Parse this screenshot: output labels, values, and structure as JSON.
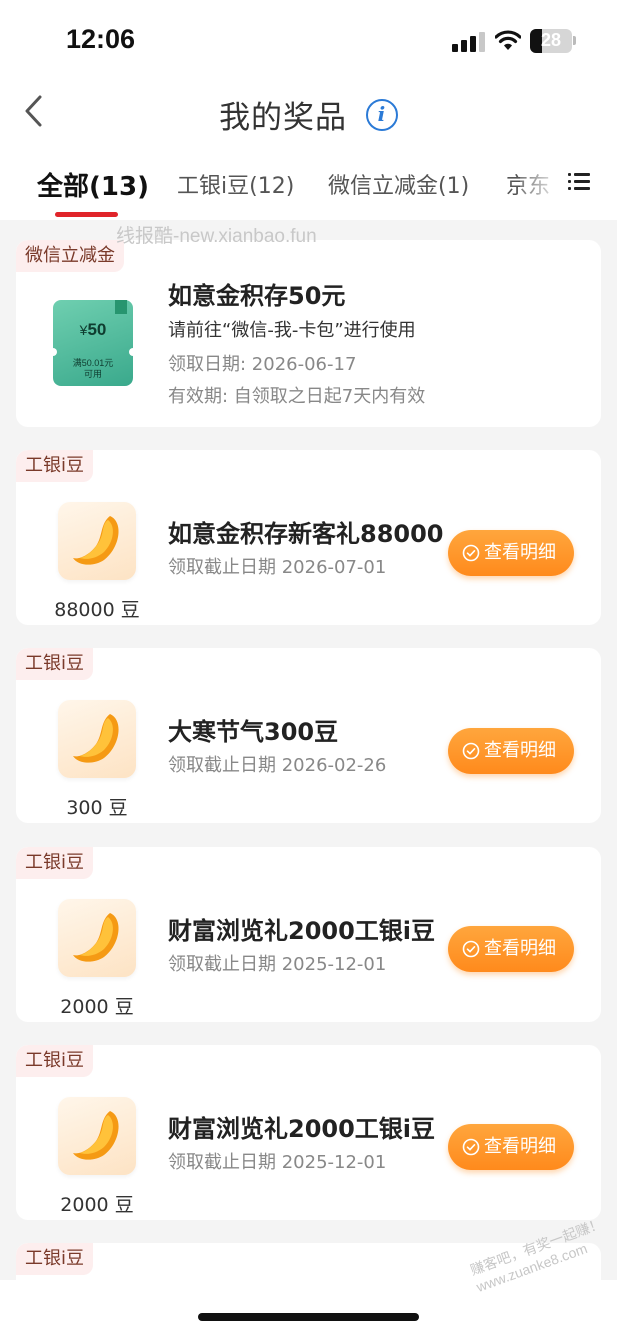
{
  "status_bar": {
    "time": "12:06",
    "battery": "28"
  },
  "header": {
    "title": "我的奖品",
    "info_icon": "info-circle-icon"
  },
  "tabs": [
    {
      "label": "全部(13)",
      "active": true
    },
    {
      "label": "工银i豆(12)"
    },
    {
      "label": "微信立减金(1)"
    },
    {
      "label": "京东"
    }
  ],
  "watermark": "线报酷-new.xianbao.fun",
  "voucher_card": {
    "tag": "微信立减金",
    "title": "如意金积存50元",
    "instruction": "请前往“微信-我-卡包”进行使用",
    "date": "领取日期: 2026-06-17",
    "validity": "有效期: 自领取之日起7天内有效",
    "voucher_amount": "50",
    "voucher_currency": "¥",
    "voucher_condition_1": "满50.01元",
    "voucher_condition_2": "可用"
  },
  "bean_cards": [
    {
      "tag": "工银i豆",
      "title": "如意金积存新客礼88000",
      "deadline": "领取截止日期 2026-07-01",
      "amount": "88000 豆",
      "button": "查看明细"
    },
    {
      "tag": "工银i豆",
      "title": "大寒节气300豆",
      "deadline": "领取截止日期 2026-02-26",
      "amount": "300 豆",
      "button": "查看明细"
    },
    {
      "tag": "工银i豆",
      "title": "财富浏览礼2000工银i豆",
      "deadline": "领取截止日期 2025-12-01",
      "amount": "2000 豆",
      "button": "查看明细"
    },
    {
      "tag": "工银i豆",
      "title": "财富浏览礼2000工银i豆",
      "deadline": "领取截止日期 2025-12-01",
      "amount": "2000 豆",
      "button": "查看明细"
    },
    {
      "tag": "工银i豆"
    }
  ],
  "stamp": "赚客吧，有奖一起赚！ www.zuanke8.com",
  "colors": {
    "accent_red": "#e0242a",
    "button_orange": "#ff8a1c",
    "info_blue": "#2b7ad6"
  }
}
